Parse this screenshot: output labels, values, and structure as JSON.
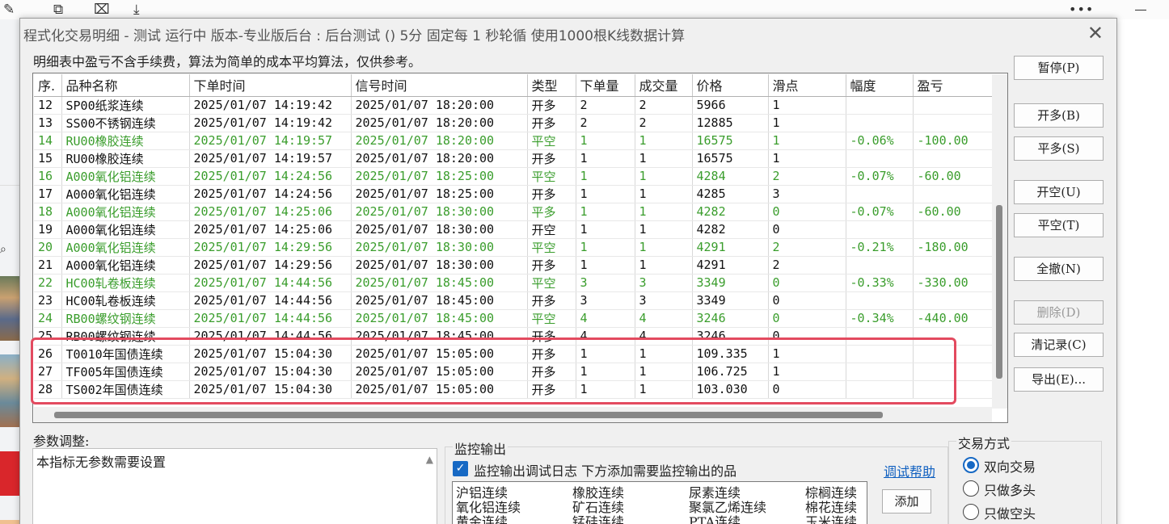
{
  "background": {
    "toolbar_icons": [
      "edit-icon",
      "export-icon",
      "excel-icon",
      "download-icon"
    ],
    "more_label": "•••"
  },
  "dialog": {
    "title": "程式化交易明细 - 测试 运行中  版本-专业版后台 : 后台测试 () 5分 固定每 1 秒轮循 使用1000根K线数据计算",
    "notice": "明细表中盈亏不含手续费，算法为简单的成本平均算法，仅供参考。",
    "close_label": "✕"
  },
  "table": {
    "columns": [
      "序.",
      "品种名称",
      "下单时间",
      "信号时间",
      "类型",
      "下单量",
      "成交量",
      "价格",
      "滑点",
      "幅度",
      "盈亏"
    ],
    "rows": [
      [
        "12",
        "SP00纸浆连续",
        "2025/01/07 14:19:42",
        "2025/01/07 18:20:00",
        "开多",
        "2",
        "2",
        "5966",
        "1",
        "",
        ""
      ],
      [
        "13",
        "SS00不锈钢连续",
        "2025/01/07 14:19:42",
        "2025/01/07 18:20:00",
        "开多",
        "2",
        "2",
        "12885",
        "1",
        "",
        ""
      ],
      [
        "14",
        "RU00橡胶连续",
        "2025/01/07 14:19:57",
        "2025/01/07 18:20:00",
        "平空",
        "1",
        "1",
        "16575",
        "1",
        "-0.06%",
        "-100.00"
      ],
      [
        "15",
        "RU00橡胶连续",
        "2025/01/07 14:19:57",
        "2025/01/07 18:20:00",
        "开多",
        "1",
        "1",
        "16575",
        "1",
        "",
        ""
      ],
      [
        "16",
        "A000氧化铝连续",
        "2025/01/07 14:24:56",
        "2025/01/07 18:25:00",
        "平空",
        "1",
        "1",
        "4284",
        "2",
        "-0.07%",
        "-60.00"
      ],
      [
        "17",
        "A000氧化铝连续",
        "2025/01/07 14:24:56",
        "2025/01/07 18:25:00",
        "开多",
        "1",
        "1",
        "4285",
        "3",
        "",
        ""
      ],
      [
        "18",
        "A000氧化铝连续",
        "2025/01/07 14:25:06",
        "2025/01/07 18:30:00",
        "平多",
        "1",
        "1",
        "4282",
        "0",
        "-0.07%",
        "-60.00"
      ],
      [
        "19",
        "A000氧化铝连续",
        "2025/01/07 14:25:06",
        "2025/01/07 18:30:00",
        "开空",
        "1",
        "1",
        "4282",
        "0",
        "",
        ""
      ],
      [
        "20",
        "A000氧化铝连续",
        "2025/01/07 14:29:56",
        "2025/01/07 18:30:00",
        "平空",
        "1",
        "1",
        "4291",
        "2",
        "-0.21%",
        "-180.00"
      ],
      [
        "21",
        "A000氧化铝连续",
        "2025/01/07 14:29:56",
        "2025/01/07 18:30:00",
        "开多",
        "1",
        "1",
        "4291",
        "2",
        "",
        ""
      ],
      [
        "22",
        "HC00轧卷板连续",
        "2025/01/07 14:44:56",
        "2025/01/07 18:45:00",
        "平空",
        "3",
        "3",
        "3349",
        "0",
        "-0.33%",
        "-330.00"
      ],
      [
        "23",
        "HC00轧卷板连续",
        "2025/01/07 14:44:56",
        "2025/01/07 18:45:00",
        "开多",
        "3",
        "3",
        "3349",
        "0",
        "",
        ""
      ],
      [
        "24",
        "RB00螺纹钢连续",
        "2025/01/07 14:44:56",
        "2025/01/07 18:45:00",
        "平空",
        "4",
        "4",
        "3246",
        "0",
        "-0.34%",
        "-440.00"
      ],
      [
        "25",
        "RB00螺纹钢连续",
        "2025/01/07 14:44:56",
        "2025/01/07 18:45:00",
        "开多",
        "4",
        "4",
        "3246",
        "0",
        "",
        ""
      ],
      [
        "26",
        "T0010年国债连续",
        "2025/01/07 15:04:30",
        "2025/01/07 15:05:00",
        "开多",
        "1",
        "1",
        "109.335",
        "1",
        "",
        ""
      ],
      [
        "27",
        "TF005年国债连续",
        "2025/01/07 15:04:30",
        "2025/01/07 15:05:00",
        "开多",
        "1",
        "1",
        "106.725",
        "1",
        "",
        ""
      ],
      [
        "28",
        "TS002年国债连续",
        "2025/01/07 15:04:30",
        "2025/01/07 15:05:00",
        "开多",
        "1",
        "1",
        "103.030",
        "0",
        "",
        ""
      ]
    ],
    "green_rows": [
      2,
      4,
      6,
      8,
      10,
      12
    ],
    "green_color": "#3a9d2c",
    "highlight_color": "#e34a5f"
  },
  "side_buttons": [
    {
      "label": "暂停(P)",
      "enabled": true
    },
    {
      "label": "开多(B)",
      "enabled": true
    },
    {
      "label": "平多(S)",
      "enabled": true
    },
    {
      "label": "开空(U)",
      "enabled": true
    },
    {
      "label": "平空(T)",
      "enabled": true
    },
    {
      "label": "全撤(N)",
      "enabled": true
    },
    {
      "label": "删除(D)",
      "enabled": false
    },
    {
      "label": "清记录(C)",
      "enabled": true
    },
    {
      "label": "导出(E)...",
      "enabled": true
    }
  ],
  "params": {
    "label": "参数调整:",
    "text": "本指标无参数需要设置"
  },
  "monitor": {
    "group_label": "监控输出",
    "checkbox_label": "监控输出调试日志 下方添加需要监控输出的品",
    "checked": true,
    "help_link": "调试帮助",
    "add_label": "添加",
    "items": [
      "沪铝连续",
      "橡胶连续",
      "尿素连续",
      "棕榈连续",
      "氧化铝连续",
      "矿石连续",
      "聚氯乙烯连续",
      "棉花连续",
      "黄金连续",
      "锰硅连续",
      "PTA连续",
      "玉米连续"
    ]
  },
  "trade_mode": {
    "group_label": "交易方式",
    "options": [
      "双向交易",
      "只做多头",
      "只做空头"
    ],
    "selected": 0
  },
  "colors": {
    "accent": "#1769c4",
    "link": "#1060c0"
  }
}
